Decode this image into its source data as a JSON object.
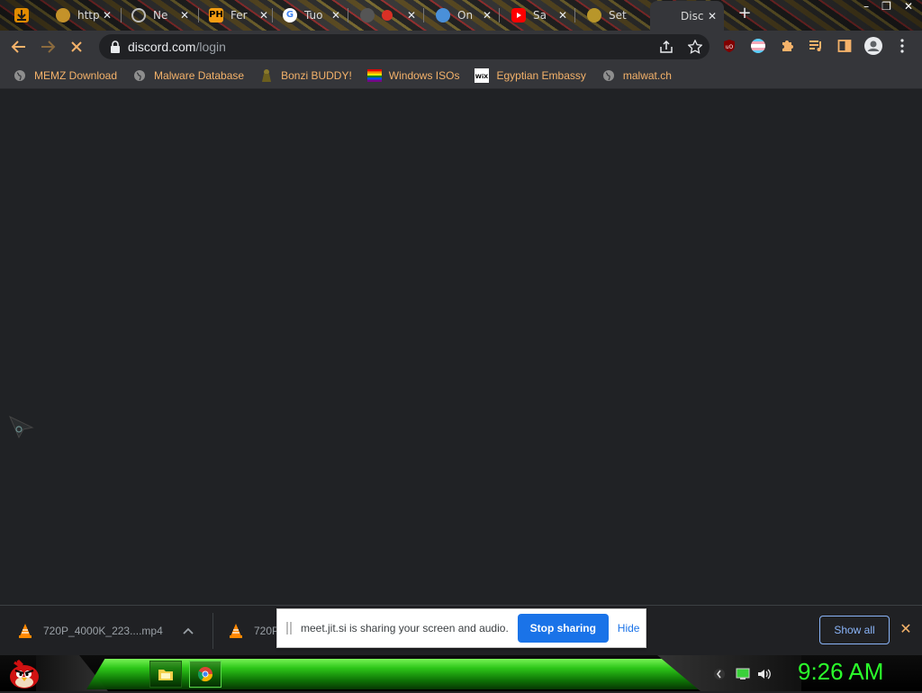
{
  "browser": {
    "tabs": [
      {
        "icon": "download-icon",
        "title": "",
        "favicon_text": ""
      },
      {
        "icon": "globe-icon",
        "title": "http",
        "favicon_text": ""
      },
      {
        "icon": "chrome-icon",
        "title": "Ne",
        "favicon_text": ""
      },
      {
        "icon": "ph-icon",
        "title": "Fer",
        "favicon_text": "PH"
      },
      {
        "icon": "google-icon",
        "title": "Tuo",
        "favicon_text": "G"
      },
      {
        "icon": "record-icon",
        "title": "",
        "favicon_text": ""
      },
      {
        "icon": "search-icon",
        "title": "On",
        "favicon_text": ""
      },
      {
        "icon": "youtube-icon",
        "title": "Sa",
        "favicon_text": ""
      },
      {
        "icon": "globe-icon",
        "title": "Set",
        "favicon_text": ""
      },
      {
        "icon": "discord-icon",
        "title": "Disc",
        "favicon_text": "",
        "active": true
      }
    ],
    "url_host": "discord.com",
    "url_path": "/login",
    "colors": {
      "bookmark_text": "#f4b26a",
      "toolbar": "#35363a",
      "omnibox": "#202124",
      "content": "#202225"
    }
  },
  "bookmarks": [
    {
      "icon": "globe-icon",
      "label": "MEMZ Download"
    },
    {
      "icon": "globe-icon",
      "label": "Malware Database"
    },
    {
      "icon": "bonzi-icon",
      "label": "Bonzi BUDDY!"
    },
    {
      "icon": "rainbow-flag-icon",
      "label": "Windows ISOs"
    },
    {
      "icon": "wix-icon",
      "label": "Egyptian Embassy"
    },
    {
      "icon": "globe-icon",
      "label": "malwat.ch"
    }
  ],
  "downloads": [
    {
      "icon": "vlc-icon",
      "name": "720P_4000K_223....mp4"
    },
    {
      "icon": "vlc-icon",
      "name": "720P"
    }
  ],
  "shelf": {
    "show_all": "Show all",
    "close": "✕"
  },
  "share_bar": {
    "message": "meet.jit.si is sharing your screen and audio.",
    "stop_label": "Stop sharing",
    "hide_label": "Hide",
    "accent": "#1a73e8"
  },
  "taskbar": {
    "clock": "9:26 AM",
    "clock_color": "#2bff2b"
  }
}
